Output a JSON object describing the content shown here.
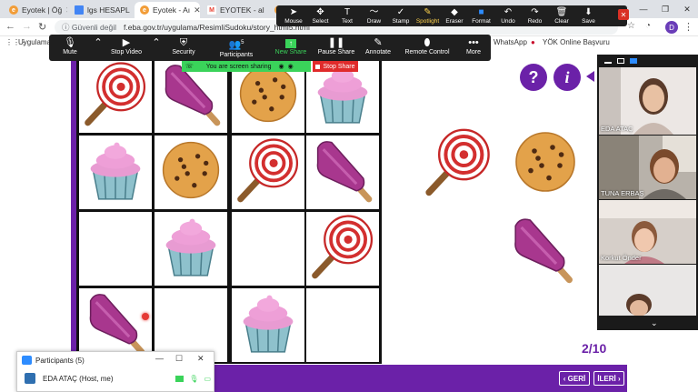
{
  "browser": {
    "tabs": [
      {
        "label": "Eyotek | Öğ",
        "favicon": "eyotek-icon",
        "color": "#f29d38"
      },
      {
        "label": "lgs HESAPL",
        "favicon": "doc-icon",
        "color": "#4285f4"
      },
      {
        "label": "Eyotek - Aı",
        "favicon": "eyotek-icon",
        "color": "#f29d38"
      },
      {
        "label": "EYOTEK - al",
        "favicon": "gmail-icon",
        "color": "#ea4335"
      },
      {
        "label": "",
        "favicon": "eyotek-icon",
        "color": "#f29d38"
      }
    ],
    "address": {
      "security": "Güvenli değil",
      "url": "f.eba.gov.tr/uygulama/ResimliSudoku/story_html5.html"
    },
    "profile_initial": "D",
    "bookmarks": [
      {
        "label": "Uygulamala"
      },
      {
        "label": "WhatsApp"
      },
      {
        "label": "YÖK Online Başvuru"
      }
    ]
  },
  "zoom_toolbar": {
    "tools": [
      {
        "label": "Mouse",
        "icon": "mouse-pointer-icon",
        "glyph": "➤"
      },
      {
        "label": "Select",
        "icon": "select-icon",
        "glyph": "✥"
      },
      {
        "label": "Text",
        "icon": "text-icon",
        "glyph": "T"
      },
      {
        "label": "Draw",
        "icon": "draw-icon",
        "glyph": "〜"
      },
      {
        "label": "Stamp",
        "icon": "stamp-icon",
        "glyph": "✓"
      },
      {
        "label": "Spotlight",
        "icon": "spotlight-icon",
        "glyph": "✎"
      },
      {
        "label": "Eraser",
        "icon": "eraser-icon",
        "glyph": "◆"
      },
      {
        "label": "Format",
        "icon": "format-icon",
        "glyph": "■"
      },
      {
        "label": "Undo",
        "icon": "undo-icon",
        "glyph": "↶"
      },
      {
        "label": "Redo",
        "icon": "redo-icon",
        "glyph": "↷"
      },
      {
        "label": "Clear",
        "icon": "clear-icon",
        "glyph": "🗑"
      },
      {
        "label": "Save",
        "icon": "save-icon",
        "glyph": "⬇"
      }
    ]
  },
  "meeting_controls": {
    "mute": "Mute",
    "stop_video": "Stop Video",
    "security": "Security",
    "participants": "Participants",
    "participants_count": "5",
    "new_share": "New Share",
    "pause_share": "Pause Share",
    "annotate": "Annotate",
    "remote_control": "Remote Control",
    "more": "More",
    "sharing_status": "You are screen sharing",
    "stop_share": "Stop Share"
  },
  "sudoku": {
    "cells": [
      [
        "lollipop",
        "popsicle",
        "cookie",
        "cupcake"
      ],
      [
        "cupcake",
        "cookie",
        "lollipop",
        "popsicle"
      ],
      [
        "",
        "cupcake",
        "",
        "lollipop"
      ],
      [
        "popsicle",
        "",
        "cupcake",
        ""
      ]
    ],
    "choices": [
      "lollipop",
      "cookie",
      "popsicle"
    ]
  },
  "page": {
    "help_glyph": "?",
    "info_glyph": "i",
    "counter": "2/10",
    "prev": "GERİ",
    "next": "İLERİ",
    "prev_arrow": "‹",
    "next_arrow": "›"
  },
  "videos": [
    {
      "name": "EDA ATAÇ"
    },
    {
      "name": "TUNA ERBAŞ"
    },
    {
      "name": "Korkut Önder"
    },
    {
      "name": ""
    }
  ],
  "participants_panel": {
    "title": "Participants (5)",
    "row": {
      "name": "EDA ATAÇ (Host, me)"
    }
  },
  "colors": {
    "brand_purple": "#6b21a8",
    "zoom_green": "#3ad35a",
    "stop_red": "#e02b2b"
  }
}
